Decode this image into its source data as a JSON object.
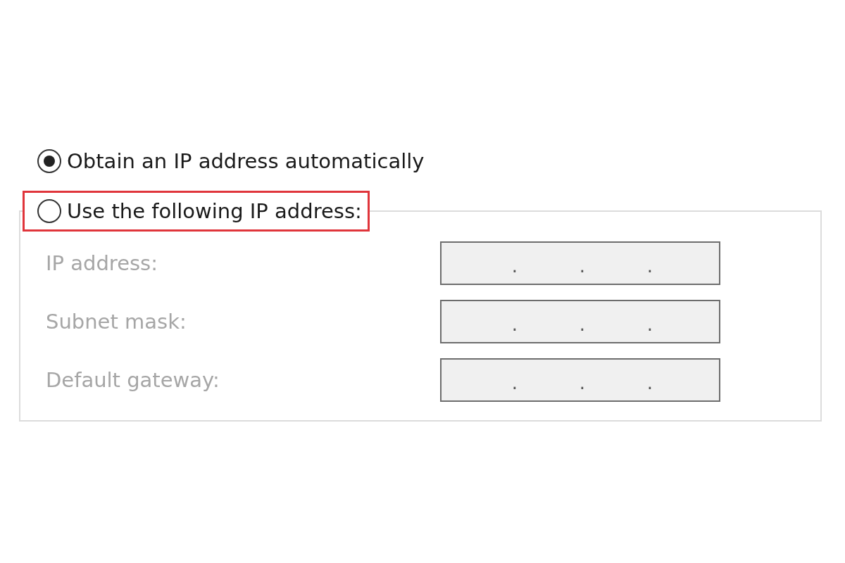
{
  "ip_settings": {
    "options": [
      {
        "label": "Obtain an IP address automatically",
        "selected": true,
        "highlighted": false
      },
      {
        "label": "Use the following IP address:",
        "selected": false,
        "highlighted": true
      }
    ],
    "fields": [
      {
        "label": "IP address:",
        "disabled": true,
        "separators": [
          ".",
          ".",
          "."
        ]
      },
      {
        "label": "Subnet mask:",
        "disabled": true,
        "separators": [
          ".",
          ".",
          "."
        ]
      },
      {
        "label": "Default gateway:",
        "disabled": true,
        "separators": [
          ".",
          ".",
          "."
        ]
      }
    ]
  }
}
